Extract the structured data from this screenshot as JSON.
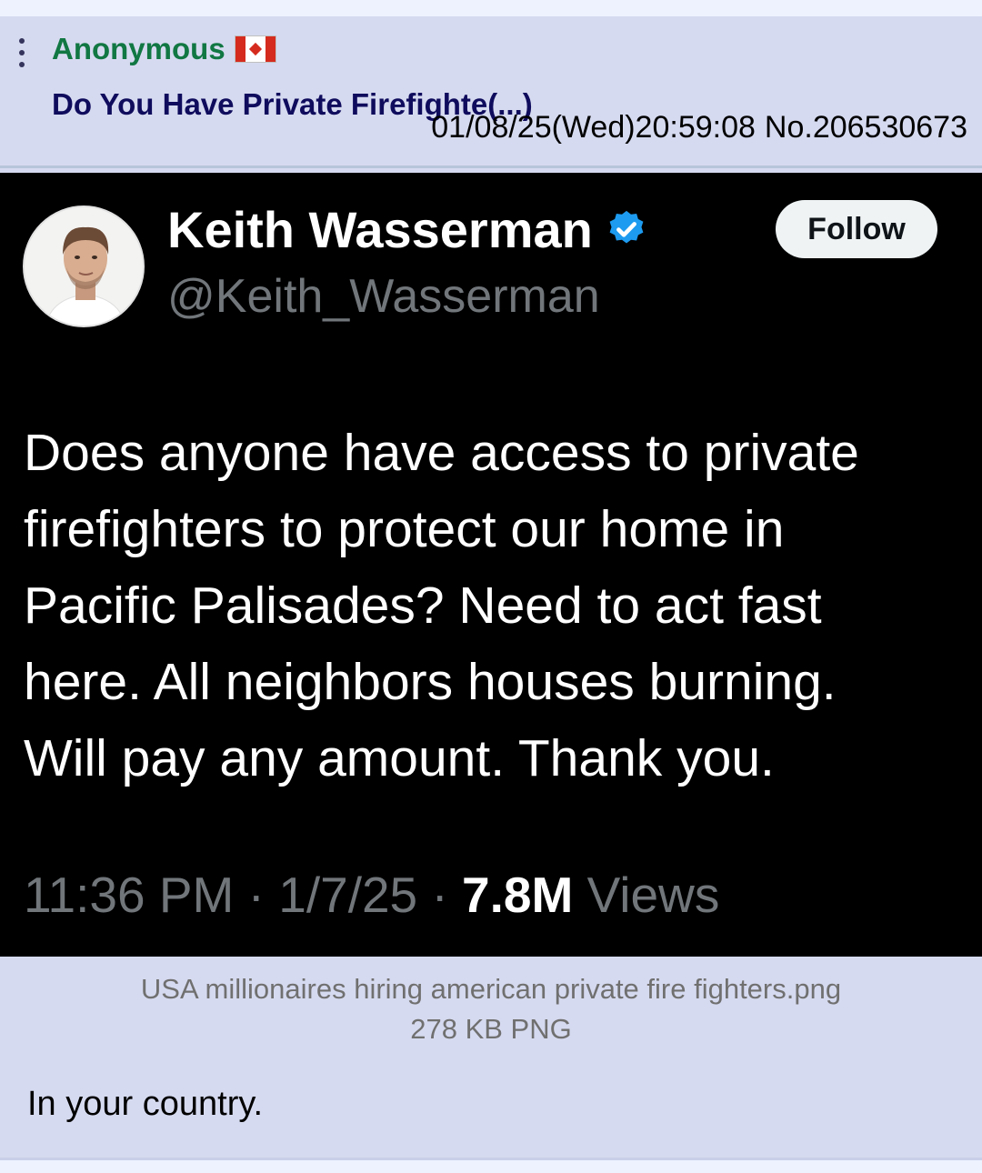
{
  "post": {
    "poster_name": "Anonymous",
    "country": "Canada",
    "flag_icon": "canada-flag-icon",
    "subject": "Do You Have Private Firefighte(...)",
    "datetime": "01/08/25(Wed)20:59:08",
    "post_number": "No.206530673",
    "comment": "In your country."
  },
  "file": {
    "name": "USA millionaires hiring american private fire fighters.png",
    "info": "278 KB PNG"
  },
  "tweet": {
    "display_name": "Keith Wasserman",
    "handle": "@Keith_Wasserman",
    "follow_label": "Follow",
    "text": "Does anyone have access to private\nfirefighters to protect our home in\nPacific Palisades? Need to act fast\nhere. All neighbors houses burning.\nWill pay any amount. Thank you.",
    "time": "11:36 PM",
    "date": "1/7/25",
    "views_count": "7.8M",
    "views_label": "Views",
    "separator": "·"
  },
  "colors": {
    "name_green": "#117743",
    "subject_blue": "#0f0c5d",
    "post_bg": "#d6daf0",
    "page_bg": "#eef2ff",
    "verified_blue": "#1d9bf0"
  }
}
